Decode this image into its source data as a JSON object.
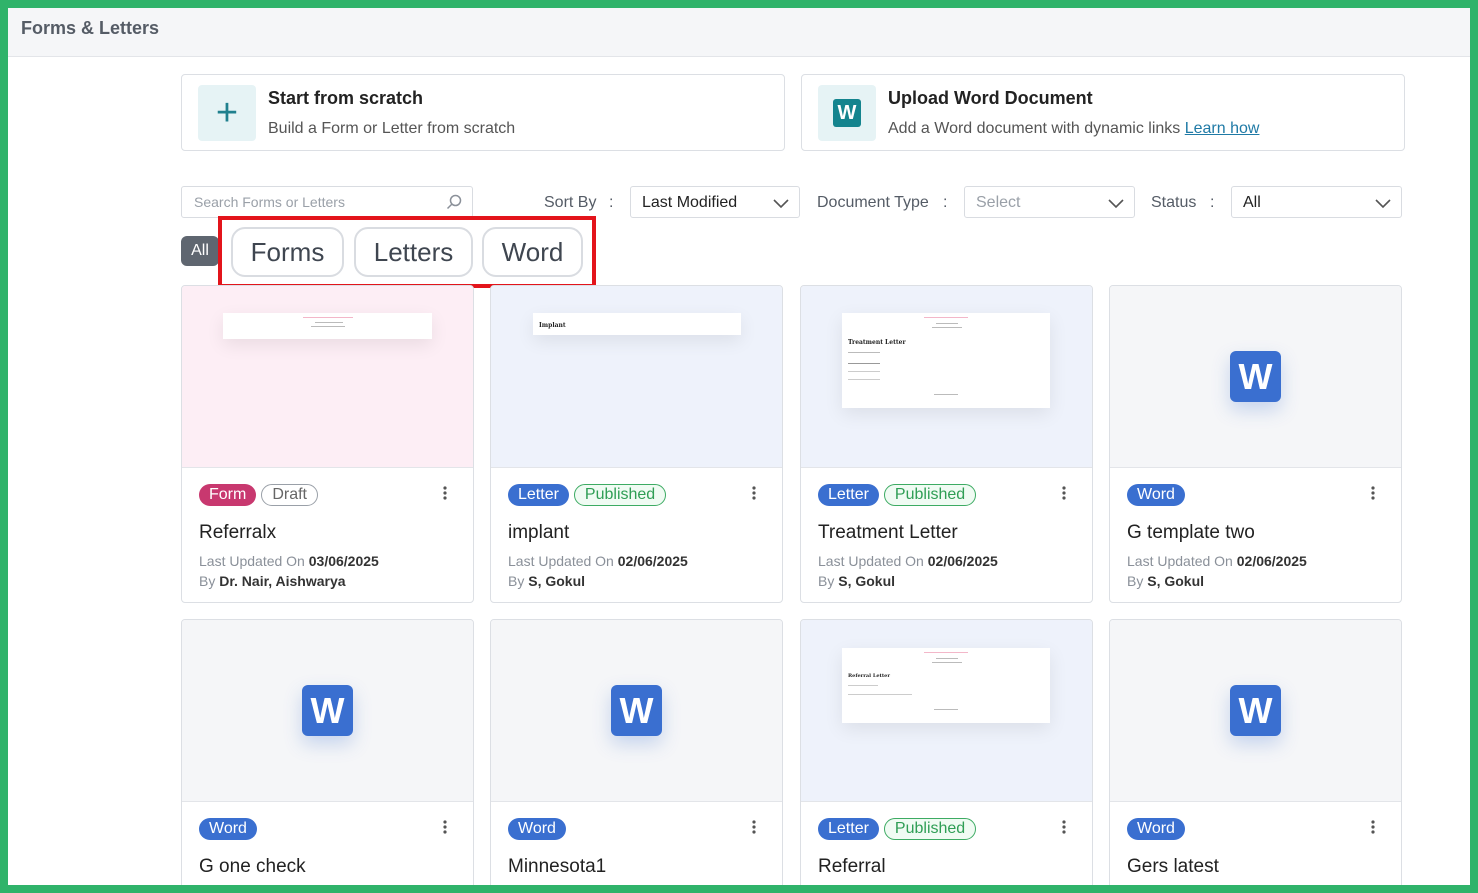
{
  "header": {
    "title": "Forms & Letters"
  },
  "start_cards": [
    {
      "title": "Start from scratch",
      "subtitle": "Build a Form or Letter from scratch"
    },
    {
      "title": "Upload Word Document",
      "subtitle": "Add a Word document with dynamic links",
      "link": "Learn how",
      "icon_letter": "W"
    }
  ],
  "filters": {
    "search_placeholder": "Search Forms or Letters",
    "sort_label": "Sort By",
    "sort_value": "Last Modified",
    "doctype_label": "Document Type",
    "doctype_placeholder": "Select",
    "status_label": "Status",
    "status_value": "All",
    "colon": ":"
  },
  "tabs": {
    "all": "All",
    "forms": "Forms",
    "letters": "Letters",
    "word": "Word"
  },
  "colors": {
    "accent": "#3a6fd0",
    "form_badge": "#c8386f",
    "published": "#2f9e55",
    "highlight": "#e3141b",
    "frame": "#2fb36a"
  },
  "cards": [
    {
      "type": "Form",
      "status": "Draft",
      "name": "Referralx",
      "updated_label": "Last Updated On",
      "date": "03/06/2025",
      "by_label": "By",
      "author": "Dr. Nair, Aishwarya"
    },
    {
      "type": "Letter",
      "status": "Published",
      "name": "implant",
      "updated_label": "Last Updated On",
      "date": "02/06/2025",
      "by_label": "By",
      "author": "S, Gokul",
      "preview_title": "Implant"
    },
    {
      "type": "Letter",
      "status": "Published",
      "name": "Treatment Letter",
      "updated_label": "Last Updated On",
      "date": "02/06/2025",
      "by_label": "By",
      "author": "S, Gokul",
      "preview_title": "Treatment Letter"
    },
    {
      "type": "Word",
      "name": "G template two",
      "updated_label": "Last Updated On",
      "date": "02/06/2025",
      "by_label": "By",
      "author": "S, Gokul",
      "icon_letter": "W"
    },
    {
      "type": "Word",
      "name": "G one check",
      "icon_letter": "W"
    },
    {
      "type": "Word",
      "name": "Minnesota1",
      "icon_letter": "W"
    },
    {
      "type": "Letter",
      "status": "Published",
      "name": "Referral",
      "preview_title": "Referral Letter"
    },
    {
      "type": "Word",
      "name": "Gers latest",
      "icon_letter": "W"
    }
  ]
}
